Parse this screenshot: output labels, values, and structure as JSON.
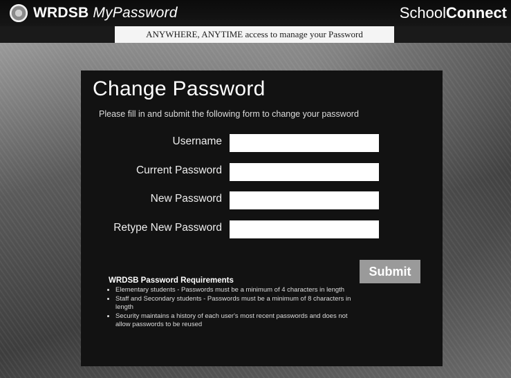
{
  "header": {
    "brand_bold": "WRDSB",
    "brand_italic": "MyPassword",
    "school_regular": "School",
    "school_bold": "Connect",
    "tagline": "ANYWHERE, ANYTIME access to manage your Password"
  },
  "form": {
    "title": "Change Password",
    "subtitle": "Please fill in and submit the following form to change your password",
    "fields": [
      {
        "label": "Username",
        "value": ""
      },
      {
        "label": "Current Password",
        "value": ""
      },
      {
        "label": "New Password",
        "value": ""
      },
      {
        "label": "Retype New Password",
        "value": ""
      }
    ],
    "submit_label": "Submit"
  },
  "requirements": {
    "heading": "WRDSB Password Requirements",
    "items": [
      "Elementary students - Passwords must be a minimum of 4 characters in length",
      "Staff and Secondary students - Passwords must be a minimum of 8 characters in length",
      "Security maintains a history of each user's most recent passwords and does not allow passwords to be reused"
    ]
  }
}
